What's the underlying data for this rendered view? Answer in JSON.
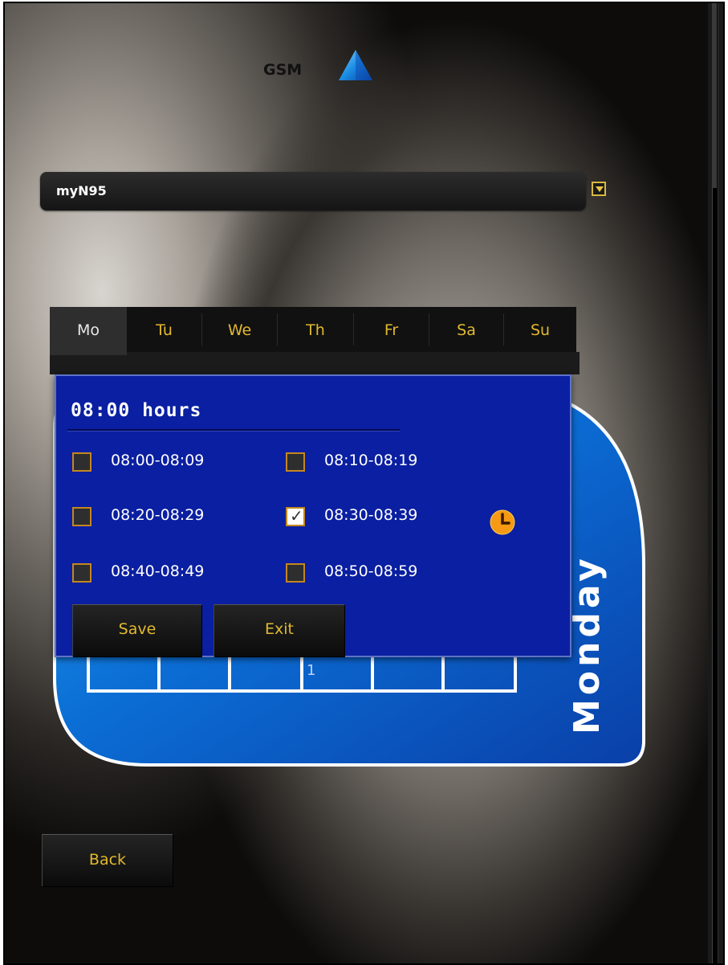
{
  "header": {
    "title": "GSM",
    "icon": "signal-triangle-icon"
  },
  "device": {
    "selected": "myN95",
    "dropdown_icon": "dropdown-arrow-icon"
  },
  "tabs": [
    {
      "label": "Mo",
      "active": true
    },
    {
      "label": "Tu",
      "active": false
    },
    {
      "label": "We",
      "active": false
    },
    {
      "label": "Th",
      "active": false
    },
    {
      "label": "Fr",
      "active": false
    },
    {
      "label": "Sa",
      "active": false
    },
    {
      "label": "Su",
      "active": false
    }
  ],
  "day_card": {
    "day_label": "Monday",
    "grid_marker": "1"
  },
  "dialog": {
    "title": "08:00 hours",
    "slots": [
      {
        "label": "08:00-08:09",
        "checked": false
      },
      {
        "label": "08:10-08:19",
        "checked": false
      },
      {
        "label": "08:20-08:29",
        "checked": false
      },
      {
        "label": "08:30-08:39",
        "checked": true
      },
      {
        "label": "08:40-08:49",
        "checked": false
      },
      {
        "label": "08:50-08:59",
        "checked": false
      }
    ],
    "clock_icon": "clock-icon",
    "save_label": "Save",
    "exit_label": "Exit"
  },
  "footer": {
    "back_label": "Back"
  },
  "colors": {
    "accent_gold": "#e2b92e",
    "dialog_blue": "#0a1fa1",
    "card_blue": "#0a5ec7",
    "clock_orange": "#f59a12"
  }
}
